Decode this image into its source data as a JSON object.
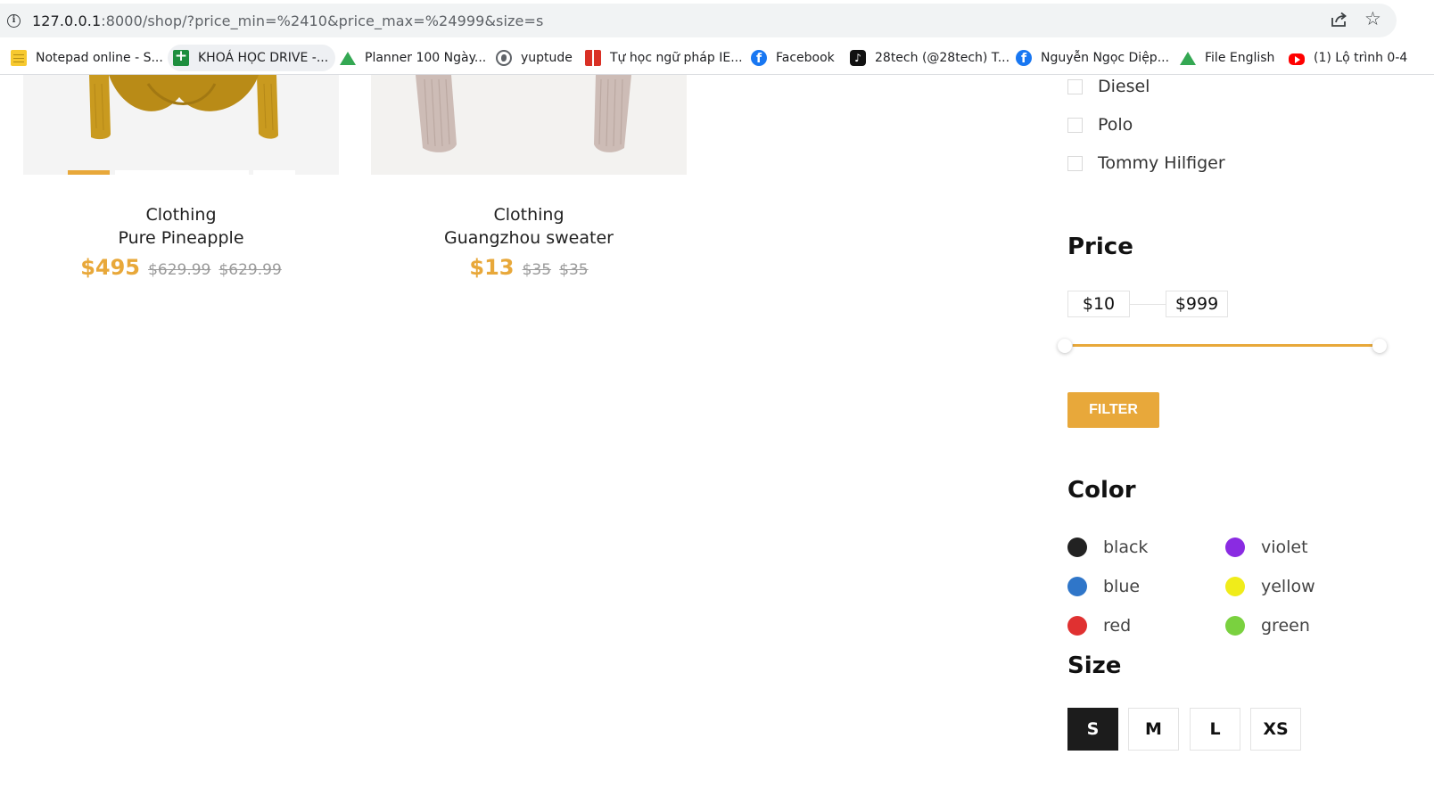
{
  "browser": {
    "url_host": "127.0.0.1",
    "url_rest": ":8000/shop/?price_min=%2410&price_max=%24999&size=s",
    "bookmarks": [
      {
        "label": "Notepad online - S...",
        "icon": "notepad-icon"
      },
      {
        "label": "KHOÁ HỌC DRIVE -...",
        "icon": "sheets-icon"
      },
      {
        "label": "Planner 100 Ngày...",
        "icon": "drive-icon"
      },
      {
        "label": "yuptude",
        "icon": "globe-icon"
      },
      {
        "label": "Tự học ngữ pháp IE...",
        "icon": "ielts-icon"
      },
      {
        "label": "Facebook",
        "icon": "facebook-icon"
      },
      {
        "label": "28tech (@28tech) T...",
        "icon": "tiktok-icon"
      },
      {
        "label": "Nguyễn Ngọc Diệp...",
        "icon": "facebook-icon"
      },
      {
        "label": "File English",
        "icon": "drive-icon"
      },
      {
        "label": "(1) Lộ trình 0-4",
        "icon": "youtube-icon"
      }
    ]
  },
  "products": [
    {
      "category": "Clothing",
      "name": "Pure Pineapple",
      "price": "$495",
      "old_price_1": "$629.99",
      "old_price_2": "$629.99",
      "image_color": "#c99a1f"
    },
    {
      "category": "Clothing",
      "name": "Guangzhou sweater",
      "price": "$13",
      "old_price_1": "$35",
      "old_price_2": "$35",
      "image_color": "#cdbcb6"
    }
  ],
  "sidebar": {
    "brands": [
      "Diesel",
      "Polo",
      "Tommy Hilfiger"
    ],
    "price_heading": "Price",
    "price_min": "$10",
    "price_max": "$999",
    "filter_label": "FILTER",
    "color_heading": "Color",
    "colors": [
      {
        "name": "black",
        "hex": "#222222"
      },
      {
        "name": "violet",
        "hex": "#8a2be2"
      },
      {
        "name": "blue",
        "hex": "#2f76c9"
      },
      {
        "name": "yellow",
        "hex": "#f0ec1a"
      },
      {
        "name": "red",
        "hex": "#e03131"
      },
      {
        "name": "green",
        "hex": "#7ad13f"
      }
    ],
    "size_heading": "Size",
    "sizes": [
      "S",
      "M",
      "L",
      "XS"
    ],
    "selected_size": "S"
  },
  "accent_color": "#e8a83a"
}
